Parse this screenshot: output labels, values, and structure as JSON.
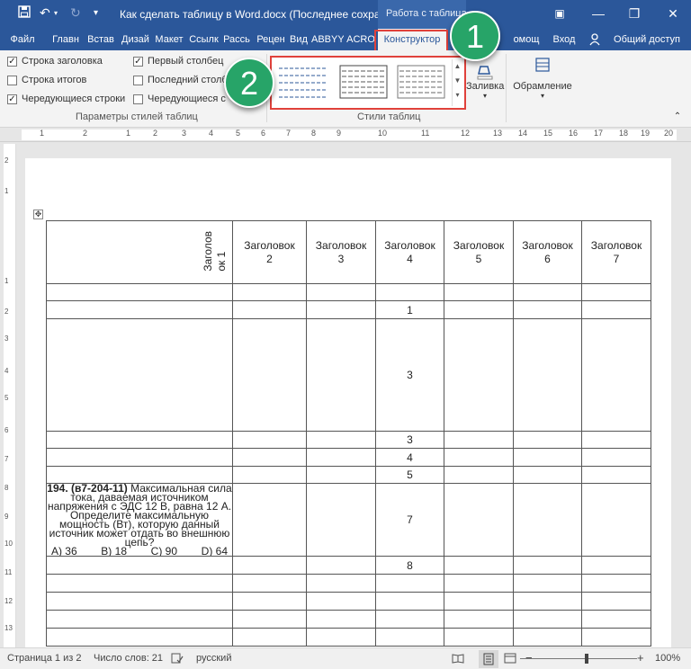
{
  "titlebar": {
    "document_title": "Как сделать таблицу в Word.docx (Последнее сохране...",
    "context_header": "Работа с таблицами",
    "save_icon": "save-icon",
    "minimize_glyph": "—",
    "restore_glyph": "❐",
    "close_glyph": "✕",
    "ribbon_options_glyph": "▣"
  },
  "tabs": [
    {
      "label": "Файл"
    },
    {
      "label": "Главн"
    },
    {
      "label": "Встав"
    },
    {
      "label": "Дизай"
    },
    {
      "label": "Макет"
    },
    {
      "label": "Ссылк"
    },
    {
      "label": "Рассь"
    },
    {
      "label": "Рецен"
    },
    {
      "label": "Вид"
    },
    {
      "label": "ABBYY"
    },
    {
      "label": "ACRO"
    },
    {
      "label": "Конструктор"
    },
    {
      "label": "омощ"
    },
    {
      "label": "Вход"
    },
    {
      "label": "Общий доступ"
    }
  ],
  "ribbon": {
    "options": [
      {
        "label": "Строка заголовка",
        "checked": true
      },
      {
        "label": "Строка итогов",
        "checked": false
      },
      {
        "label": "Чередующиеся строки",
        "checked": true
      },
      {
        "label": "Первый столбец",
        "checked": true
      },
      {
        "label": "Последний столб",
        "checked": false
      },
      {
        "label": "Чередующиеся с",
        "checked": false
      }
    ],
    "group_options_label": "Параметры стилей таблиц",
    "group_styles_label": "Стили таблиц",
    "shading_label": "Заливка",
    "borders_label": "Обрамление"
  },
  "callouts": [
    "1",
    "2"
  ],
  "ruler": {
    "marks": [
      "1",
      "2",
      "1",
      "2",
      "3",
      "4",
      "5",
      "6",
      "7",
      "8",
      "9",
      "10",
      "11",
      "12",
      "13",
      "14",
      "15",
      "16",
      "17",
      "18",
      "19",
      "20"
    ],
    "vmarks": [
      "2",
      "1",
      "1",
      "2",
      "3",
      "4",
      "5",
      "6",
      "7",
      "8",
      "9",
      "10",
      "11",
      "12",
      "13"
    ]
  },
  "table": {
    "headers": [
      "Заголов\nок 1",
      "Заголовок\n2",
      "Заголовок\n3",
      "Заголовок\n4",
      "Заголовок\n5",
      "Заголовок\n6",
      "Заголовок\n7"
    ],
    "col4_values": [
      "",
      "1",
      "3",
      "3",
      "4",
      "5",
      "7",
      "8",
      "",
      "",
      "",
      "",
      ""
    ],
    "question": {
      "number": "194.",
      "code": "(в7-204-11)",
      "text": "Максимальная сила тока, даваемая источником напряжения с ЭДС 12 В, равна 12 А. Определите максимальную мощность (Вт), которую данный источник может отдать во внешнюю цепь?",
      "answers": "А) 36        В) 18        С) 90        D) 64"
    }
  },
  "status": {
    "page": "Страница 1 из 2",
    "words": "Число слов: 21",
    "language": "русский",
    "zoom": "100%",
    "zoom_minus": "−",
    "zoom_plus": "+"
  }
}
